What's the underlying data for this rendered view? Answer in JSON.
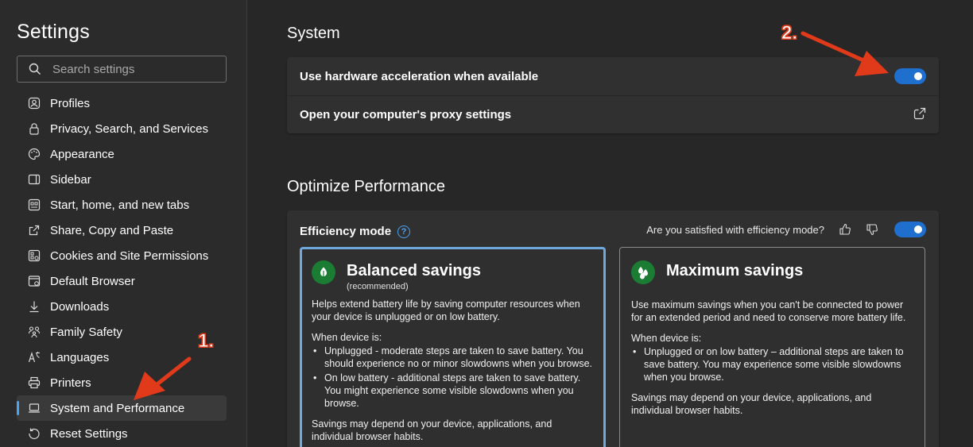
{
  "sidebar": {
    "title": "Settings",
    "search_placeholder": "Search settings",
    "items": [
      {
        "label": "Profiles",
        "icon": "profile-icon"
      },
      {
        "label": "Privacy, Search, and Services",
        "icon": "lock-icon"
      },
      {
        "label": "Appearance",
        "icon": "palette-icon"
      },
      {
        "label": "Sidebar",
        "icon": "sidebar-icon"
      },
      {
        "label": "Start, home, and new tabs",
        "icon": "home-tabs-icon"
      },
      {
        "label": "Share, Copy and Paste",
        "icon": "share-icon"
      },
      {
        "label": "Cookies and Site Permissions",
        "icon": "cookies-icon"
      },
      {
        "label": "Default Browser",
        "icon": "browser-icon"
      },
      {
        "label": "Downloads",
        "icon": "download-icon"
      },
      {
        "label": "Family Safety",
        "icon": "family-icon"
      },
      {
        "label": "Languages",
        "icon": "languages-icon"
      },
      {
        "label": "Printers",
        "icon": "printer-icon"
      },
      {
        "label": "System and Performance",
        "icon": "laptop-icon",
        "active": true
      },
      {
        "label": "Reset Settings",
        "icon": "reset-icon"
      }
    ]
  },
  "system": {
    "heading": "System",
    "hardware_acceleration": {
      "label": "Use hardware acceleration when available",
      "enabled": true
    },
    "proxy": {
      "label": "Open your computer's proxy settings"
    }
  },
  "performance": {
    "heading": "Optimize Performance",
    "efficiency": {
      "label": "Efficiency mode",
      "help": "?",
      "feedback_question": "Are you satisfied with efficiency mode?",
      "enabled": true
    },
    "balanced": {
      "title": "Balanced savings",
      "subtitle": "(recommended)",
      "description": "Helps extend battery life by saving computer resources when your device is unplugged or on low battery.",
      "when": "When device is:",
      "bullets": [
        "Unplugged - moderate steps are taken to save battery. You should experience no or minor slowdowns when you browse.",
        "On low battery - additional steps are taken to save battery. You might experience some visible slowdowns when you browse."
      ],
      "note": "Savings may depend on your device, applications, and individual browser habits."
    },
    "maximum": {
      "title": "Maximum savings",
      "description": "Use maximum savings when you can't be connected to power for an extended period and need to conserve more battery life.",
      "when": "When device is:",
      "bullets": [
        "Unplugged or on low battery – additional steps are taken to save battery. You may experience some visible slowdowns when you browse."
      ],
      "note": "Savings may depend on your device, applications, and individual browser habits."
    }
  },
  "annotations": {
    "step1": "1.",
    "step2": "2."
  },
  "colors": {
    "accent": "#1f6fcf",
    "annotation": "#e03a1a",
    "selected_border": "#6fa8dc",
    "leaf_green": "#1b7d34"
  }
}
